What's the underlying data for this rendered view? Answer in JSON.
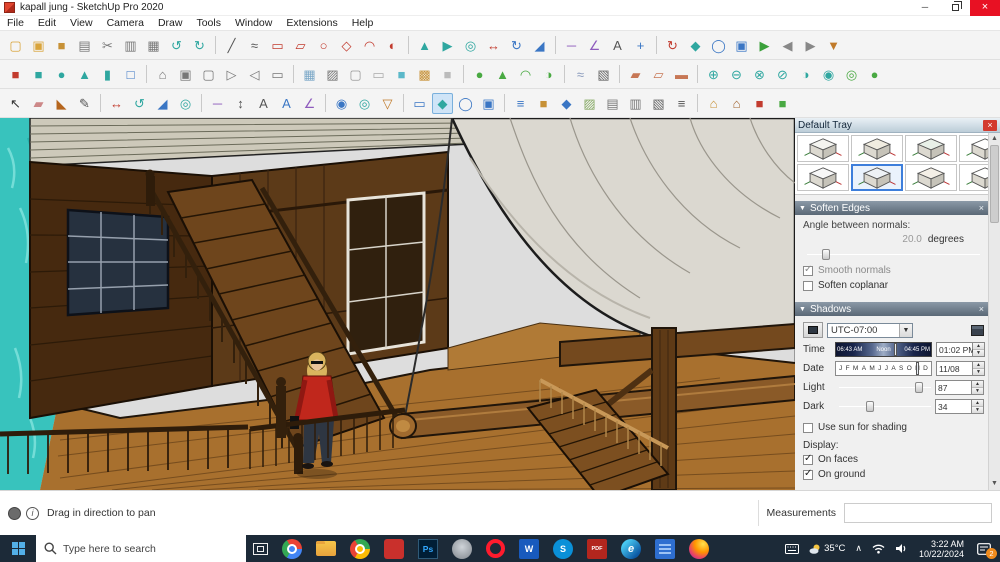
{
  "window": {
    "title": "kapall jung - SketchUp Pro 2020",
    "minimize_glyph": "─",
    "close_glyph": "×"
  },
  "menu": {
    "items": [
      "File",
      "Edit",
      "View",
      "Camera",
      "Draw",
      "Tools",
      "Window",
      "Extensions",
      "Help"
    ]
  },
  "toolbars": {
    "rows": [
      [
        {
          "n": "new",
          "g": "▢",
          "c": "#d9a43b"
        },
        {
          "n": "open",
          "g": "▣",
          "c": "#d9a43b"
        },
        {
          "n": "save",
          "g": "■",
          "c": "#c79136"
        },
        {
          "n": "print",
          "g": "▤",
          "c": "#777777"
        },
        {
          "n": "cut",
          "g": "✂",
          "c": "#777777"
        },
        {
          "n": "copy",
          "g": "▥",
          "c": "#777777"
        },
        {
          "n": "paste",
          "g": "▦",
          "c": "#777777"
        },
        {
          "n": "undo",
          "g": "↺",
          "c": "#2fa7a0"
        },
        {
          "n": "redo",
          "g": "↻",
          "c": "#2fa7a0"
        },
        {
          "sep": true
        },
        {
          "n": "line",
          "g": "╱",
          "c": "#555555"
        },
        {
          "n": "freehand",
          "g": "≈",
          "c": "#555555"
        },
        {
          "n": "rectangle",
          "g": "▭",
          "c": "#c23b2e"
        },
        {
          "n": "rotated-rectangle",
          "g": "▱",
          "c": "#c23b2e"
        },
        {
          "n": "circle",
          "g": "○",
          "c": "#c23b2e"
        },
        {
          "n": "polygon",
          "g": "◇",
          "c": "#c23b2e"
        },
        {
          "n": "arc",
          "g": "◠",
          "c": "#c23b2e"
        },
        {
          "n": "pie",
          "g": "◐",
          "c": "#c23b2e"
        },
        {
          "sep": true
        },
        {
          "n": "push-pull",
          "g": "▲",
          "c": "#2fa7a0"
        },
        {
          "n": "follow-me",
          "g": "▶",
          "c": "#2fa7a0"
        },
        {
          "n": "offset",
          "g": "◎",
          "c": "#2fa7a0"
        },
        {
          "n": "move",
          "g": "↔",
          "c": "#c23b2e"
        },
        {
          "n": "rotate",
          "g": "↻",
          "c": "#3a76c4"
        },
        {
          "n": "scale",
          "g": "◢",
          "c": "#3a76c4"
        },
        {
          "sep": true
        },
        {
          "n": "tape-measure",
          "g": "─",
          "c": "#8e5bbd"
        },
        {
          "n": "protractor",
          "g": "∠",
          "c": "#8e5bbd"
        },
        {
          "n": "text",
          "g": "A",
          "c": "#555555"
        },
        {
          "n": "axes",
          "g": "+",
          "c": "#3a76c4"
        },
        {
          "sep": true
        },
        {
          "n": "orbit",
          "g": "↻",
          "c": "#c23b2e"
        },
        {
          "n": "pan",
          "g": "◆",
          "c": "#2fa7a0"
        },
        {
          "n": "zoom",
          "g": "◯",
          "c": "#3a76c4"
        },
        {
          "n": "zoom-extents",
          "g": "▣",
          "c": "#3a76c4"
        },
        {
          "n": "play",
          "g": "▶",
          "c": "#3aa03a"
        },
        {
          "n": "previous",
          "g": "◀",
          "c": "#888888"
        },
        {
          "n": "next",
          "g": "▶",
          "c": "#888888"
        },
        {
          "n": "walk",
          "g": "▼",
          "c": "#c07a2a"
        }
      ],
      [
        {
          "n": "cube-highlight",
          "g": "■",
          "c": "#c23b2e"
        },
        {
          "n": "cube",
          "g": "■",
          "c": "#2fa7a0"
        },
        {
          "n": "sphere",
          "g": "●",
          "c": "#2fa7a0"
        },
        {
          "n": "cone",
          "g": "▲",
          "c": "#2fa7a0"
        },
        {
          "n": "cylinder",
          "g": "▮",
          "c": "#2fa7a0"
        },
        {
          "n": "box",
          "g": "□",
          "c": "#3a76c4"
        },
        {
          "sep": true
        },
        {
          "n": "iso-view",
          "g": "⌂",
          "c": "#777777"
        },
        {
          "n": "top-view",
          "g": "▣",
          "c": "#777777"
        },
        {
          "n": "front-view",
          "g": "▢",
          "c": "#777777"
        },
        {
          "n": "right-view",
          "g": "▷",
          "c": "#777777"
        },
        {
          "n": "back-view",
          "g": "◁",
          "c": "#777777"
        },
        {
          "n": "left-view",
          "g": "▭",
          "c": "#777777"
        },
        {
          "sep": true
        },
        {
          "n": "x-ray",
          "g": "▦",
          "c": "#7aa7c7"
        },
        {
          "n": "back-edges",
          "g": "▨",
          "c": "#777777"
        },
        {
          "n": "wireframe",
          "g": "▢",
          "c": "#999999"
        },
        {
          "n": "hidden-line",
          "g": "▭",
          "c": "#aaaaaa"
        },
        {
          "n": "shaded",
          "g": "■",
          "c": "#5bb8c9"
        },
        {
          "n": "shaded-textures",
          "g": "▩",
          "c": "#c79136"
        },
        {
          "n": "monochrome",
          "g": "■",
          "c": "#bbbbbb"
        },
        {
          "sep": true
        },
        {
          "n": "sphere-green",
          "g": "●",
          "c": "#49a942"
        },
        {
          "n": "cone-green",
          "g": "▲",
          "c": "#49a942"
        },
        {
          "n": "arc-green",
          "g": "◠",
          "c": "#49a942"
        },
        {
          "n": "pie-green",
          "g": "◑",
          "c": "#49a942"
        },
        {
          "sep": true
        },
        {
          "n": "fog",
          "g": "≈",
          "c": "#8899bb"
        },
        {
          "n": "shadows-toggle",
          "g": "▧",
          "c": "#666666"
        },
        {
          "sep": true
        },
        {
          "n": "section-plane",
          "g": "▰",
          "c": "#c77755"
        },
        {
          "n": "section-fill",
          "g": "▱",
          "c": "#c77755"
        },
        {
          "n": "section-display",
          "g": "▬",
          "c": "#c77755"
        },
        {
          "sep": true
        },
        {
          "n": "union",
          "g": "⊕",
          "c": "#2fa7a0"
        },
        {
          "n": "subtract",
          "g": "⊖",
          "c": "#2fa7a0"
        },
        {
          "n": "intersect",
          "g": "⊗",
          "c": "#2fa7a0"
        },
        {
          "n": "trim",
          "g": "⊘",
          "c": "#2fa7a0"
        },
        {
          "n": "split",
          "g": "◑",
          "c": "#2fa7a0"
        },
        {
          "n": "outer-shell",
          "g": "◉",
          "c": "#2fa7a0"
        },
        {
          "n": "soften-edges",
          "g": "◎",
          "c": "#49a942"
        },
        {
          "n": "smooth",
          "g": "●",
          "c": "#49a942"
        }
      ],
      [
        {
          "n": "select",
          "g": "↖",
          "c": "#333333"
        },
        {
          "n": "eraser",
          "g": "▰",
          "c": "#cc8888"
        },
        {
          "n": "paint-bucket",
          "g": "◣",
          "c": "#b5651d"
        },
        {
          "n": "pencil",
          "g": "✎",
          "c": "#555555"
        },
        {
          "sep": true
        },
        {
          "n": "move-tool",
          "g": "↔",
          "c": "#c23b2e"
        },
        {
          "n": "rotate-tool",
          "g": "↺",
          "c": "#2fa7a0"
        },
        {
          "n": "scale-tool",
          "g": "◢",
          "c": "#3a76c4"
        },
        {
          "n": "offset-tool",
          "g": "◎",
          "c": "#2fa7a0"
        },
        {
          "sep": true
        },
        {
          "n": "tape",
          "g": "─",
          "c": "#8e5bbd"
        },
        {
          "n": "dimension",
          "g": "↕",
          "c": "#555555"
        },
        {
          "n": "text-tool",
          "g": "A",
          "c": "#555555"
        },
        {
          "n": "3d-text",
          "g": "A",
          "c": "#3a76c4"
        },
        {
          "n": "protractor-tool",
          "g": "∠",
          "c": "#8e5bbd"
        },
        {
          "sep": true
        },
        {
          "n": "position-camera",
          "g": "◉",
          "c": "#3a76c4"
        },
        {
          "n": "look-around",
          "g": "◎",
          "c": "#2fa7a0"
        },
        {
          "n": "walk-tool",
          "g": "▽",
          "c": "#c07a2a"
        },
        {
          "sep": true
        },
        {
          "n": "zoom-window",
          "g": "▭",
          "c": "#3a76c4"
        },
        {
          "n": "pan-tool",
          "g": "◆",
          "c": "#2fa7a0",
          "sel": true
        },
        {
          "n": "zoom-tool",
          "g": "◯",
          "c": "#3a76c4"
        },
        {
          "n": "zoom-extents-2",
          "g": "▣",
          "c": "#3a76c4"
        },
        {
          "sep": true
        },
        {
          "n": "entity-info",
          "g": "≡",
          "c": "#3a76c4"
        },
        {
          "n": "materials",
          "g": "■",
          "c": "#c79136"
        },
        {
          "n": "components",
          "g": "◆",
          "c": "#3a76c4"
        },
        {
          "n": "styles",
          "g": "▨",
          "c": "#88aa66"
        },
        {
          "n": "layers",
          "g": "▤",
          "c": "#777777"
        },
        {
          "n": "scenes",
          "g": "▥",
          "c": "#777777"
        },
        {
          "n": "shadow-settings",
          "g": "▧",
          "c": "#666666"
        },
        {
          "n": "model-info",
          "g": "≡",
          "c": "#555555"
        },
        {
          "sep": true
        },
        {
          "n": "3d-warehouse",
          "g": "⌂",
          "c": "#c79136"
        },
        {
          "n": "extension-warehouse",
          "g": "⌂",
          "c": "#a0622d"
        },
        {
          "n": "layout",
          "g": "■",
          "c": "#c23b2e"
        },
        {
          "n": "style-builder",
          "g": "■",
          "c": "#49a942"
        }
      ]
    ]
  },
  "viewport": {
    "scene": "3D model: wooden ship-house deck with cabin, staircases, woman in red jacket, large gray sail over a wooden boom, turquoise water"
  },
  "tray": {
    "title": "Default Tray",
    "styles": {
      "thumbs": [
        {
          "tint": "#f4f4f0"
        },
        {
          "tint": "#f0ece0"
        },
        {
          "tint": "#e8f0e8"
        },
        {
          "tint": "#ffffff"
        },
        {
          "tint": "#f7f7f7"
        },
        {
          "tint": "#eef2f6",
          "selected": true
        },
        {
          "tint": "#f4efe6"
        },
        {
          "tint": "#ffffff"
        }
      ]
    },
    "soften_edges": {
      "title": "Soften Edges",
      "angle_label": "Angle between normals:",
      "angle_value": "20.0",
      "angle_unit": "degrees",
      "handle_pct": 11,
      "smooth_label": "Smooth normals",
      "smooth_checked": true,
      "coplanar_label": "Soften coplanar",
      "coplanar_checked": false
    },
    "shadows": {
      "title": "Shadows",
      "timezone": "UTC-07:00",
      "time_label": "Time",
      "time_marks": [
        "06:43 AM",
        "Noon",
        "04:45 PM"
      ],
      "time_value": "01:02 PM",
      "time_handle_pct": 63,
      "date_label": "Date",
      "date_letters": "J F M A M J J A S O N D",
      "date_value": "11/08",
      "date_handle_pct": 86,
      "light_label": "Light",
      "light_value": 87,
      "dark_label": "Dark",
      "dark_value": 34,
      "use_sun_label": "Use sun for shading",
      "use_sun_checked": false,
      "display_label": "Display:",
      "on_faces_label": "On faces",
      "on_faces_checked": true,
      "on_ground_label": "On ground",
      "on_ground_checked": true
    }
  },
  "statusbar": {
    "hint": "Drag in direction to pan",
    "measurements_label": "Measurements"
  },
  "taskbar": {
    "search_placeholder": "Type here to search",
    "apps": [
      {
        "n": "task-view",
        "cls": "app-taskview"
      },
      {
        "n": "chrome",
        "cls": "app-chrome"
      },
      {
        "n": "file-explorer",
        "cls": "app-folder"
      },
      {
        "n": "chrome-secondary",
        "cls": "app-chrome2"
      },
      {
        "n": "adobe-app",
        "cls": "app-red"
      },
      {
        "n": "photoshop",
        "cls": "app-ps",
        "label": "Ps"
      },
      {
        "n": "gray-app",
        "cls": "app-gray"
      },
      {
        "n": "opera",
        "cls": "app-opera"
      },
      {
        "n": "word",
        "cls": "app-word",
        "label": "W"
      },
      {
        "n": "skype",
        "cls": "app-skype",
        "label": "S"
      },
      {
        "n": "pdf-reader",
        "cls": "app-pdf",
        "label": "PDF"
      },
      {
        "n": "edge",
        "cls": "app-edge",
        "label": "e"
      },
      {
        "n": "monitor-app",
        "cls": "app-monitor"
      },
      {
        "n": "firefox",
        "cls": "app-firefox"
      }
    ],
    "weather": "35°C",
    "chevron": "∧",
    "time": "3:22 AM",
    "date": "10/22/2024",
    "badge": "2"
  }
}
